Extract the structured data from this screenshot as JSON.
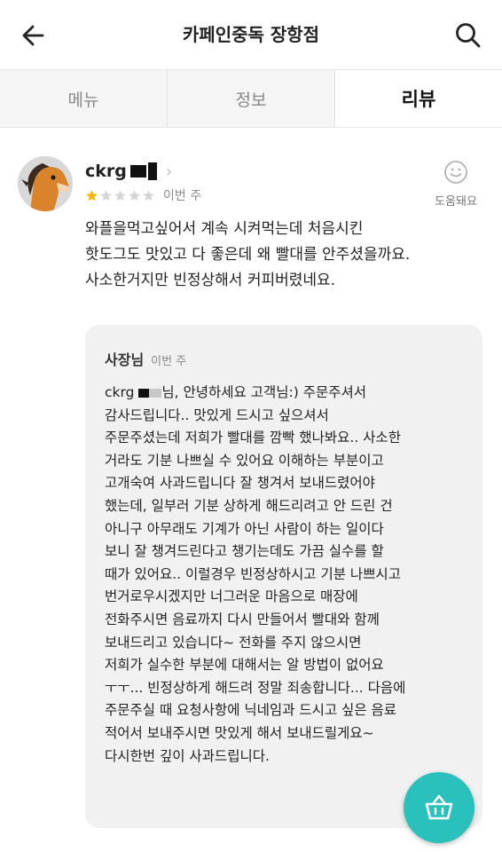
{
  "header": {
    "title": "카페인중독 장항점",
    "back_icon": "arrow-left-icon",
    "search_icon": "search-icon"
  },
  "tabs": [
    {
      "label": "메뉴",
      "active": false
    },
    {
      "label": "정보",
      "active": false
    },
    {
      "label": "리뷰",
      "active": true
    }
  ],
  "review": {
    "nickname": "ckrg",
    "rating": 1,
    "max_rating": 5,
    "date": "이번 주",
    "helpful_label": "도움돼요",
    "helpful_icon": "smile-icon",
    "text_lines": [
      "와플을먹고싶어서 계속 시켜먹는데 처음시킨",
      "핫도그도 맛있고 다 좋은데 왜 빨대를 안주셨을까요.",
      "사소한거지만 빈정상해서 커피버렸네요."
    ]
  },
  "reply": {
    "author": "사장님",
    "date": "이번 주",
    "first_line_prefix": "ckrg",
    "first_line_suffix": "님, 안녕하세요 고객님:) 주문주셔서",
    "lines": [
      "감사드립니다.. 맛있게 드시고 싶으셔서",
      "주문주셨는데 저희가 빨대를 깜빡 했나봐요.. 사소한",
      "거라도 기분 나쁘실 수 있어요 이해하는 부분이고",
      "고개숙여 사과드립니다 잘 챙겨서 보내드렸어야",
      "했는데, 일부러 기분 상하게 해드리려고 안 드린 건",
      "아니구 아무래도 기계가 아닌 사람이 하는 일이다",
      "보니 잘 챙겨드린다고 챙기는데도 가끔 실수를 할",
      "때가 있어요.. 이럴경우 빈정상하시고 기분 나쁘시고",
      "번거로우시겠지만 너그러운 마음으로 매장에",
      "전화주시면 음료까지 다시 만들어서 빨대와 함께",
      "보내드리고 있습니다~ 전화를 주지 않으시면",
      "저희가 실수한 부분에 대해서는 알 방법이 없어요",
      "ㅜㅜ... 빈정상하게 해드려 정말 죄송합니다... 다음에",
      "주문주실 때 요청사항에 닉네임과 드시고 싶은 음료",
      "적어서 보내주시면 맛있게 해서 보내드릴게요~",
      "다시한번 깊이 사과드립니다."
    ]
  },
  "fab": {
    "icon": "basket-icon"
  },
  "colors": {
    "accent": "#2ac1bc",
    "star_filled": "#f5b700",
    "star_empty": "#d6d6d6",
    "reply_bg": "#f1f1f1"
  }
}
